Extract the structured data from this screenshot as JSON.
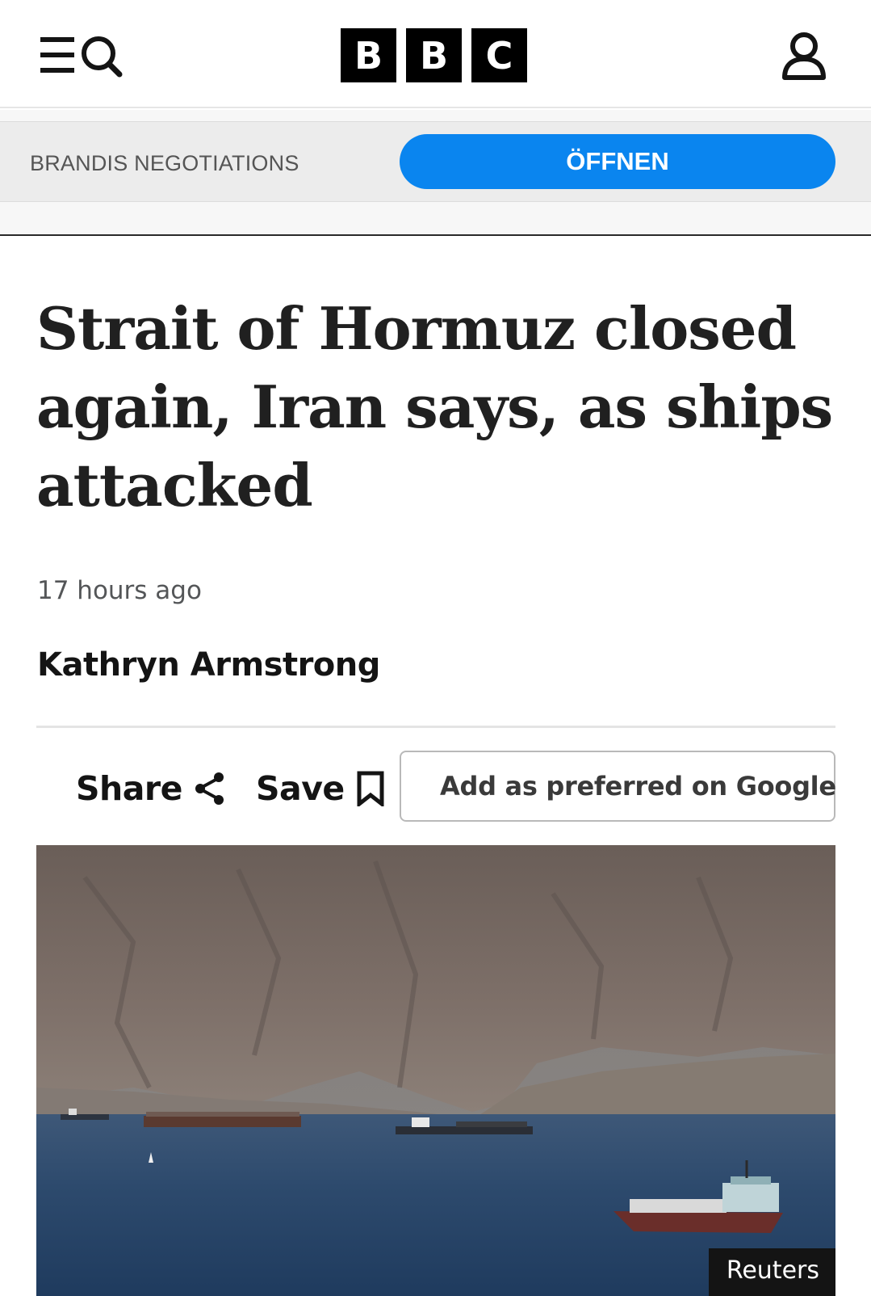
{
  "header": {
    "menu_icon": "menu-icon",
    "search_icon": "search-icon",
    "logo_letters": [
      "B",
      "B",
      "C"
    ],
    "account_icon": "account-icon"
  },
  "ad": {
    "label": "BRANDIS NEGOTIATIONS",
    "button_label": "ÖFFNEN",
    "button_color": "#0a85ef"
  },
  "article": {
    "headline": "Strait of Hormuz closed again, Iran says, as ships attacked",
    "timestamp": "17 hours ago",
    "author": "Kathryn Armstrong"
  },
  "actions": {
    "share_label": "Share",
    "save_label": "Save",
    "google_label": "Add as preferred on Google"
  },
  "image": {
    "credit": "Reuters"
  }
}
